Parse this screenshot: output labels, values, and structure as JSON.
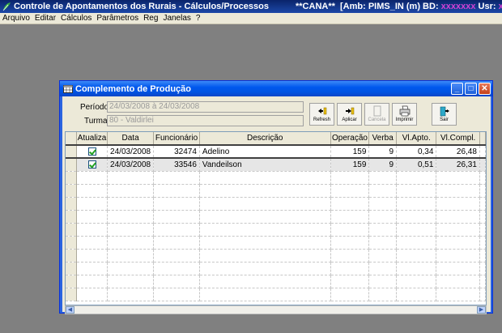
{
  "app": {
    "title": "Controle de Apontamentos dos Rurais - Cálculos/Processos",
    "env": "**CANA**",
    "amb_prefix": "[Amb: PIMS_IN  (m) BD: ",
    "bd_value": "xxxxxxx",
    "usr_prefix": " Usr: ",
    "usr_value": "xxxx",
    "suffix": "]"
  },
  "menu": [
    "Arquivo",
    "Editar",
    "Cálculos",
    "Parâmetros",
    "Reg",
    "Janelas",
    "?"
  ],
  "window": {
    "title": "Complemento de Produção",
    "periodo_label": "Período:",
    "periodo_value": "24/03/2008 à 24/03/2008",
    "turma_label": "Turma:",
    "turma_value": "80 - Valdirlei",
    "buttons": {
      "refresh": "Refresh",
      "aplicar": "Aplicar",
      "cancela": "Cancela",
      "imprimir": "Imprimir",
      "sair": "Sair"
    }
  },
  "grid": {
    "columns": [
      "Atualiza",
      "Data",
      "Funcionário",
      "Descrição",
      "Operação",
      "Verba",
      "Vl.Apto.",
      "Vl.Compl."
    ],
    "rows": [
      {
        "atualiza": true,
        "data": "24/03/2008",
        "funcionario": "32474",
        "descricao": "Adelino",
        "operacao": "159",
        "verba": "9",
        "vl_apto": "0,34",
        "vl_compl": "26,48"
      },
      {
        "atualiza": true,
        "data": "24/03/2008",
        "funcionario": "33546",
        "descricao": "Vandeilson",
        "operacao": "159",
        "verba": "9",
        "vl_apto": "0,51",
        "vl_compl": "26,31"
      }
    ]
  },
  "colors": {
    "title_bar": "#0054e3",
    "desktop": "#808080"
  }
}
